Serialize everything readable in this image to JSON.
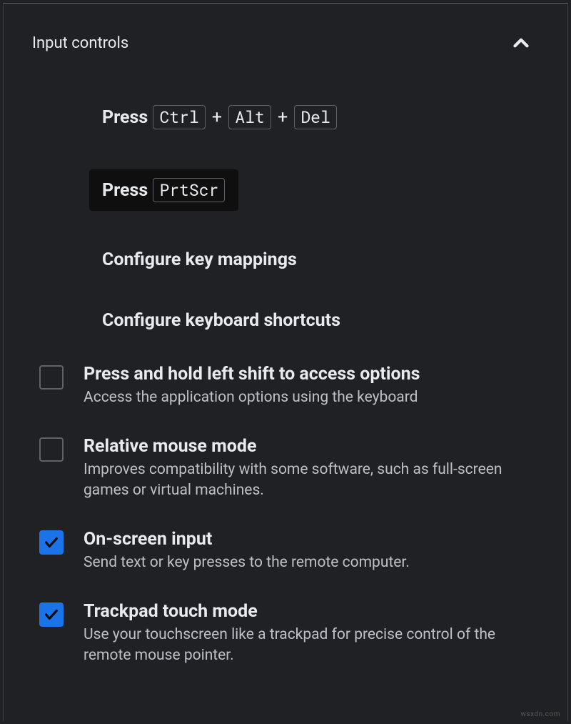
{
  "section": {
    "title": "Input controls"
  },
  "actions": {
    "press_label": "Press",
    "plus": "+",
    "ctrl": "Ctrl",
    "alt": "Alt",
    "del": "Del",
    "prtscr": "PrtScr",
    "configure_keys": "Configure key mappings",
    "configure_shortcuts": "Configure keyboard shortcuts"
  },
  "options": [
    {
      "title": "Press and hold left shift to access options",
      "desc": "Access the application options using the keyboard",
      "checked": false
    },
    {
      "title": "Relative mouse mode",
      "desc": "Improves compatibility with some software, such as full-screen games or virtual machines.",
      "checked": false
    },
    {
      "title": "On-screen input",
      "desc": "Send text or key presses to the remote computer.",
      "checked": true
    },
    {
      "title": "Trackpad touch mode",
      "desc": "Use your touchscreen like a trackpad for precise control of the remote mouse pointer.",
      "checked": true
    }
  ],
  "watermark": "wsxdn.com"
}
